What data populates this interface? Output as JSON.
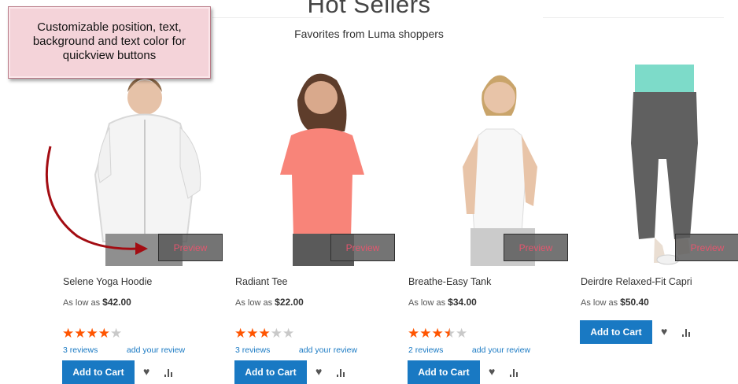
{
  "section": {
    "title": "Hot Sellers",
    "subtitle": "Favorites from Luma shoppers"
  },
  "callout": {
    "text_lines": [
      "Customizable position, text,",
      "background and text color for",
      "quickview buttons"
    ]
  },
  "colors": {
    "accent_button": "#1979c3",
    "star": "#ff5501",
    "preview_text": "#e3566e",
    "link": "#1979c3"
  },
  "products": [
    {
      "name": "Selene Yoga Hoodie",
      "price_prefix": "As low as",
      "price": "$42.00",
      "rating_stars": 4,
      "reviews_text": "3  reviews",
      "add_review": "add your review",
      "preview": "Preview",
      "cart": "Add to Cart"
    },
    {
      "name": "Radiant Tee",
      "price_prefix": "As low as",
      "price": "$22.00",
      "rating_stars": 3,
      "reviews_text": "3  reviews",
      "add_review": "add your review",
      "preview": "Preview",
      "cart": "Add to Cart"
    },
    {
      "name": "Breathe-Easy Tank",
      "price_prefix": "As low as",
      "price": "$34.00",
      "rating_stars": 3.5,
      "reviews_text": "2  reviews",
      "add_review": "add your review",
      "preview": "Preview",
      "cart": "Add to Cart"
    },
    {
      "name": "Deirdre Relaxed-Fit Capri",
      "price_prefix": "As low as",
      "price": "$50.40",
      "preview": "Preview",
      "cart": "Add to Cart"
    }
  ],
  "icons": {
    "wishlist": "heart-icon",
    "compare": "bar-chart-icon",
    "stars": "star-icon",
    "arrow": "curved-arrow"
  }
}
